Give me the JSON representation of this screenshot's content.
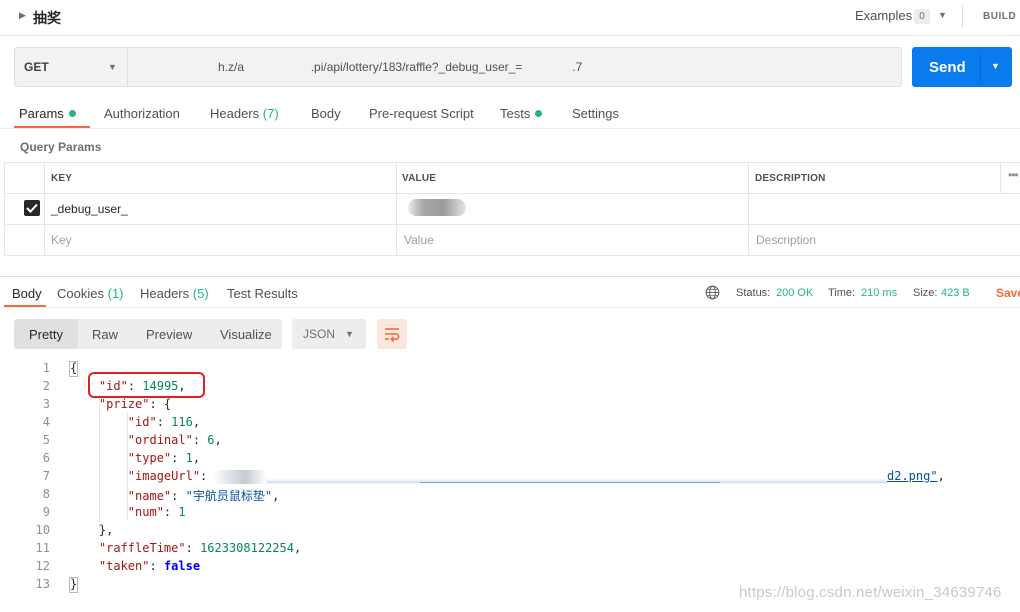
{
  "collection": {
    "title": "抽奖",
    "examples_label": "Examples",
    "examples_count": "0",
    "build_label": "BUILD"
  },
  "request": {
    "method": "GET",
    "url": "h.z/a                    .pi/api/lottery/183/raffle?_debug_user_=               .7",
    "send_label": "Send"
  },
  "request_tabs": [
    {
      "label": "Params"
    },
    {
      "label": "Authorization"
    },
    {
      "label": "Headers",
      "count": "(7)"
    },
    {
      "label": "Body"
    },
    {
      "label": "Pre-request Script"
    },
    {
      "label": "Tests"
    },
    {
      "label": "Settings"
    }
  ],
  "query_params": {
    "section_label": "Query Params",
    "headers": {
      "key": "KEY",
      "value": "VALUE",
      "description": "DESCRIPTION"
    },
    "row": {
      "key": "_debug_user_"
    },
    "placeholders": {
      "key": "Key",
      "value": "Value",
      "description": "Description"
    }
  },
  "response_tabs": [
    {
      "label": "Body"
    },
    {
      "label": "Cookies",
      "count": "(1)"
    },
    {
      "label": "Headers",
      "count": "(5)"
    },
    {
      "label": "Test Results"
    }
  ],
  "response_status": {
    "status_label": "Status:",
    "status_value": "200 OK",
    "time_label": "Time:",
    "time_value": "210 ms",
    "size_label": "Size:",
    "size_value": "423 B",
    "save_label": "Save"
  },
  "viewer": {
    "modes": [
      "Pretty",
      "Raw",
      "Preview",
      "Visualize"
    ],
    "format": "JSON"
  },
  "code": {
    "line_numbers": [
      "1",
      "2",
      "3",
      "4",
      "5",
      "6",
      "7",
      "8",
      "9",
      "10",
      "11",
      "12",
      "13"
    ],
    "open_brace": "{",
    "close_brace": "}",
    "id_key": "\"id\"",
    "id_value": "14995",
    "prize_key": "\"prize\"",
    "prize_id_key": "\"id\"",
    "prize_id_value": "116",
    "ordinal_key": "\"ordinal\"",
    "ordinal_value": "6",
    "type_key": "\"type\"",
    "type_value": "1",
    "image_key": "\"imageUrl\"",
    "image_value_tail": "d2.png\"",
    "name_key": "\"name\"",
    "name_value": "\"宇航员鼠标垫\"",
    "num_key": "\"num\"",
    "num_value": "1",
    "prize_close": "},",
    "raffle_key": "\"raffleTime\"",
    "raffle_value": "1623308122254",
    "taken_key": "\"taken\"",
    "taken_value": "false"
  },
  "watermark": "https://blog.csdn.net/weixin_34639746",
  "colors": {
    "accent_orange": "#f26b3a",
    "send_blue": "#097bed",
    "success_green": "#26b47f",
    "highlight_red": "#e02020"
  }
}
